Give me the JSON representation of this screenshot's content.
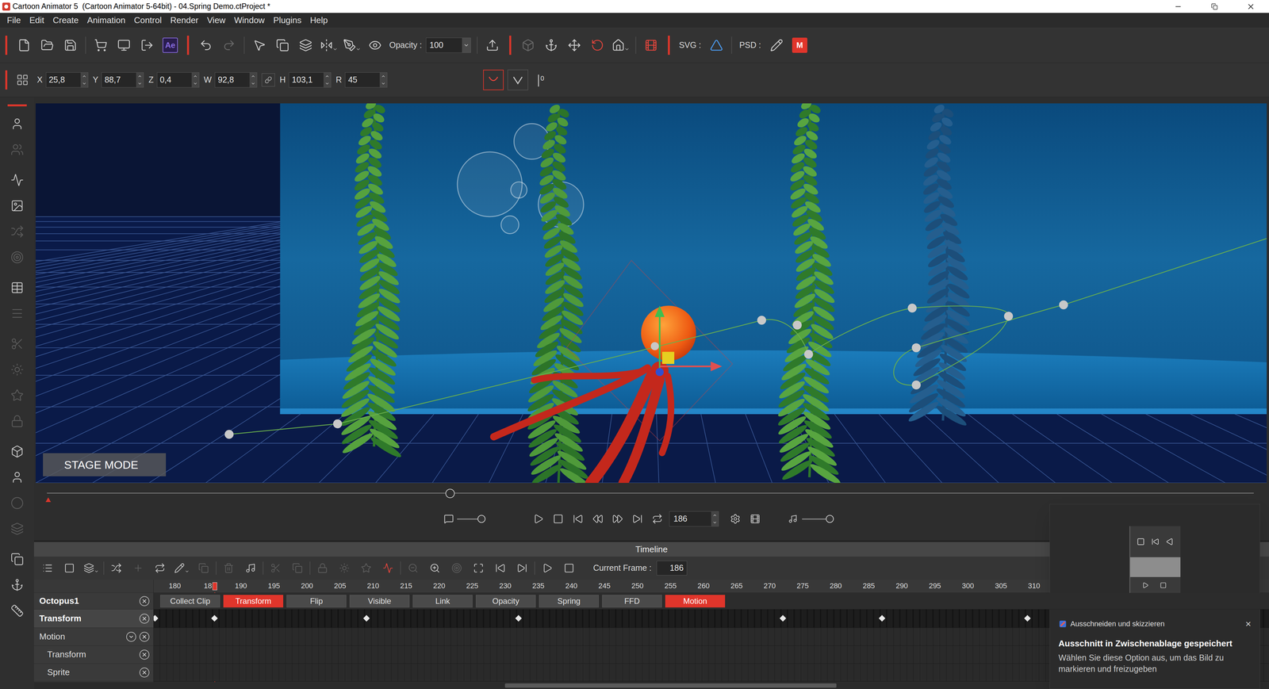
{
  "window": {
    "title": "Cartoon Animator 5  (Cartoon Animator 5-64bit) - 04.Spring Demo.ctProject *"
  },
  "menu": [
    "File",
    "Edit",
    "Create",
    "Animation",
    "Control",
    "Render",
    "View",
    "Window",
    "Plugins",
    "Help"
  ],
  "main_tools": [
    {
      "kind": "red-separator"
    },
    {
      "kind": "icon",
      "disabled": false
    },
    {
      "kind": "icon",
      "disabled": false
    },
    {
      "kind": "icon",
      "disabled": false
    },
    {
      "kind": "separator"
    },
    {
      "kind": "icon",
      "disabled": false
    },
    {
      "kind": "icon",
      "disabled": false
    },
    {
      "kind": "icon",
      "disabled": false
    },
    {
      "kind": "badge",
      "text": "Ae",
      "color": "#8a6ee0"
    },
    {
      "kind": "red-separator"
    },
    {
      "kind": "icon",
      "disabled": false
    },
    {
      "kind": "icon",
      "disabled": true
    },
    {
      "kind": "separator"
    },
    {
      "kind": "icon",
      "disabled": false
    },
    {
      "kind": "icon",
      "disabled": false
    },
    {
      "kind": "icon",
      "disabled": false
    },
    {
      "kind": "dropdown",
      "disabled": false
    },
    {
      "kind": "dropdown",
      "disabled": false
    },
    {
      "kind": "icon",
      "disabled": false
    },
    {
      "kind": "field",
      "label": "Opacity :",
      "value": "100"
    },
    {
      "kind": "separator"
    },
    {
      "kind": "icon",
      "disabled": false
    },
    {
      "kind": "red-separator"
    },
    {
      "kind": "icon",
      "disabled": true
    },
    {
      "kind": "icon",
      "disabled": false
    },
    {
      "kind": "icon",
      "disabled": false
    },
    {
      "kind": "icon",
      "disabled": false
    },
    {
      "kind": "dropdown",
      "disabled": false
    },
    {
      "kind": "separator"
    },
    {
      "kind": "icon",
      "disabled": false
    },
    {
      "kind": "red-separator"
    },
    {
      "kind": "label",
      "text": "SVG :"
    },
    {
      "kind": "icon",
      "disabled": false
    },
    {
      "kind": "separator"
    },
    {
      "kind": "label",
      "text": "PSD :"
    },
    {
      "kind": "icon",
      "disabled": false
    },
    {
      "kind": "badge",
      "text": "M",
      "color": "#e0352b"
    }
  ],
  "transform": {
    "fields": [
      {
        "label": "X",
        "value": "25,8"
      },
      {
        "label": "Y",
        "value": "88,7"
      },
      {
        "label": "Z",
        "value": "0,4"
      },
      {
        "label": "W",
        "value": "92,8"
      },
      {
        "label": "H",
        "value": "103,1"
      },
      {
        "label": "R",
        "value": "45"
      }
    ],
    "offset_badge": "0"
  },
  "left_tools": [
    {
      "disabled": false
    },
    {
      "disabled": true
    },
    {
      "disabled": false
    },
    {
      "disabled": false
    },
    {
      "disabled": true
    },
    {
      "disabled": true
    },
    {
      "disabled": false
    },
    {
      "disabled": true
    },
    {
      "disabled": true
    },
    {
      "disabled": true
    },
    {
      "disabled": true
    },
    {
      "disabled": true
    },
    {
      "disabled": false
    },
    {
      "disabled": false
    },
    {
      "disabled": true
    },
    {
      "disabled": true
    },
    {
      "disabled": false
    },
    {
      "disabled": false
    },
    {
      "disabled": false
    }
  ],
  "stage": {
    "mode_label": "STAGE MODE"
  },
  "playback": {
    "scrub_level": 0.334,
    "speed_level": 1,
    "frame": "186",
    "volume_level": 1
  },
  "timeline": {
    "title": "Timeline",
    "tools": [
      {
        "kind": "icon",
        "disabled": false
      },
      {
        "kind": "icon",
        "disabled": false
      },
      {
        "kind": "dropdown",
        "disabled": false
      },
      {
        "kind": "separator"
      },
      {
        "kind": "icon",
        "disabled": false
      },
      {
        "kind": "icon",
        "disabled": true
      },
      {
        "kind": "icon",
        "disabled": false
      },
      {
        "kind": "dropdown",
        "disabled": false
      },
      {
        "kind": "icon",
        "disabled": true
      },
      {
        "kind": "separator"
      },
      {
        "kind": "icon",
        "disabled": true
      },
      {
        "kind": "icon",
        "disabled": false
      },
      {
        "kind": "separator"
      },
      {
        "kind": "icon",
        "disabled": true
      },
      {
        "kind": "icon",
        "disabled": true
      },
      {
        "kind": "separator"
      },
      {
        "kind": "icon",
        "disabled": true
      },
      {
        "kind": "icon",
        "disabled": true
      },
      {
        "kind": "icon",
        "disabled": true
      },
      {
        "kind": "icon",
        "disabled": false
      },
      {
        "kind": "separator"
      },
      {
        "kind": "icon",
        "disabled": true
      },
      {
        "kind": "icon",
        "disabled": false
      },
      {
        "kind": "icon",
        "disabled": true
      },
      {
        "kind": "icon",
        "disabled": false
      },
      {
        "kind": "icon",
        "disabled": false
      },
      {
        "kind": "icon",
        "disabled": false
      },
      {
        "kind": "separator"
      },
      {
        "kind": "icon",
        "disabled": false
      },
      {
        "kind": "icon",
        "disabled": false
      }
    ],
    "current_frame_label": "Current Frame :",
    "current_frame": "186",
    "playhead_frame": 186,
    "ruler": [
      "180",
      "18",
      "190",
      "195",
      "200",
      "205",
      "210",
      "215",
      "220",
      "225",
      "230",
      "235",
      "240",
      "245",
      "250",
      "255",
      "260",
      "265",
      "270",
      "275",
      "280",
      "285",
      "290",
      "295",
      "300",
      "305",
      "310"
    ],
    "object": {
      "name": "Octopus1",
      "clips": [
        {
          "label": "Collect Clip",
          "selected": false
        },
        {
          "label": "Transform",
          "selected": true
        },
        {
          "label": "Flip",
          "selected": false
        },
        {
          "label": "Visible",
          "selected": false
        },
        {
          "label": "Link",
          "selected": false
        },
        {
          "label": "Opacity",
          "selected": false
        },
        {
          "label": "Spring",
          "selected": false
        },
        {
          "label": "FFD",
          "selected": false
        },
        {
          "label": "Motion",
          "selected": true
        }
      ]
    },
    "tracks": [
      {
        "name": "Transform",
        "kind": "header",
        "keyframes": [
          177,
          186,
          209,
          232,
          272,
          287,
          309
        ]
      },
      {
        "name": "Motion",
        "kind": "group",
        "keyframes": []
      },
      {
        "name": "Transform",
        "kind": "child",
        "keyframes": []
      },
      {
        "name": "Sprite",
        "kind": "child",
        "keyframes": []
      }
    ],
    "scrollbar": {
      "start": 0.315,
      "size": 0.297
    }
  },
  "notification": {
    "app": "Ausschneiden und skizzieren",
    "close": "×",
    "title": "Ausschnitt in Zwischenablage gespeichert",
    "body": "Wählen Sie diese Option aus, um das Bild zu markieren und freizugeben"
  }
}
